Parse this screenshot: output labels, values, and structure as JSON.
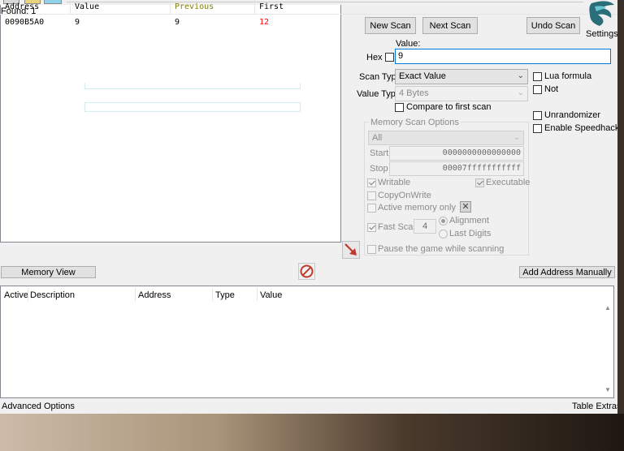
{
  "found": "Found: 1",
  "results": {
    "columns": [
      "Address",
      "Value",
      "Previous",
      "First"
    ],
    "rows": [
      {
        "address": "0090B5A0",
        "value": "9",
        "previous": "9",
        "first": "12"
      }
    ]
  },
  "buttons": {
    "new_scan": "New Scan",
    "next_scan": "Next Scan",
    "undo_scan": "Undo Scan",
    "memory_view": "Memory View",
    "add_address": "Add Address Manually"
  },
  "settings_label": "Settings",
  "value_label": "Value:",
  "hex_label": "Hex",
  "value_input": "9",
  "scan_type": {
    "label": "Scan Type",
    "selected": "Exact Value"
  },
  "value_type": {
    "label": "Value Type",
    "selected": "4 Bytes"
  },
  "options": {
    "lua_formula": "Lua formula",
    "not": "Not",
    "compare_first": "Compare to first scan",
    "unrandomizer": "Unrandomizer",
    "speedhack": "Enable Speedhack"
  },
  "memory_scan_options": {
    "title": "Memory Scan Options",
    "region": "All",
    "start_label": "Start",
    "start_value": "0000000000000000",
    "stop_label": "Stop",
    "stop_value": "00007fffffffffff",
    "writable": "Writable",
    "executable": "Executable",
    "copy_on_write": "CopyOnWrite",
    "active_memory": "Active memory only",
    "fast_scan": "Fast Scan",
    "fast_scan_value": "4",
    "alignment": "Alignment",
    "last_digits": "Last Digits",
    "pause": "Pause the game while scanning"
  },
  "address_list": {
    "columns": [
      "Active",
      "Description",
      "Address",
      "Type",
      "Value"
    ]
  },
  "status": {
    "advanced_options": "Advanced Options",
    "table_extras": "Table Extras"
  },
  "colors": {
    "previous_header": "#808000",
    "first_header": "#000000",
    "first_value": "#ff0000",
    "accent_border": "#0078d7",
    "stop_icon": "#c0392b",
    "arrow_icon": "#c0392b"
  }
}
